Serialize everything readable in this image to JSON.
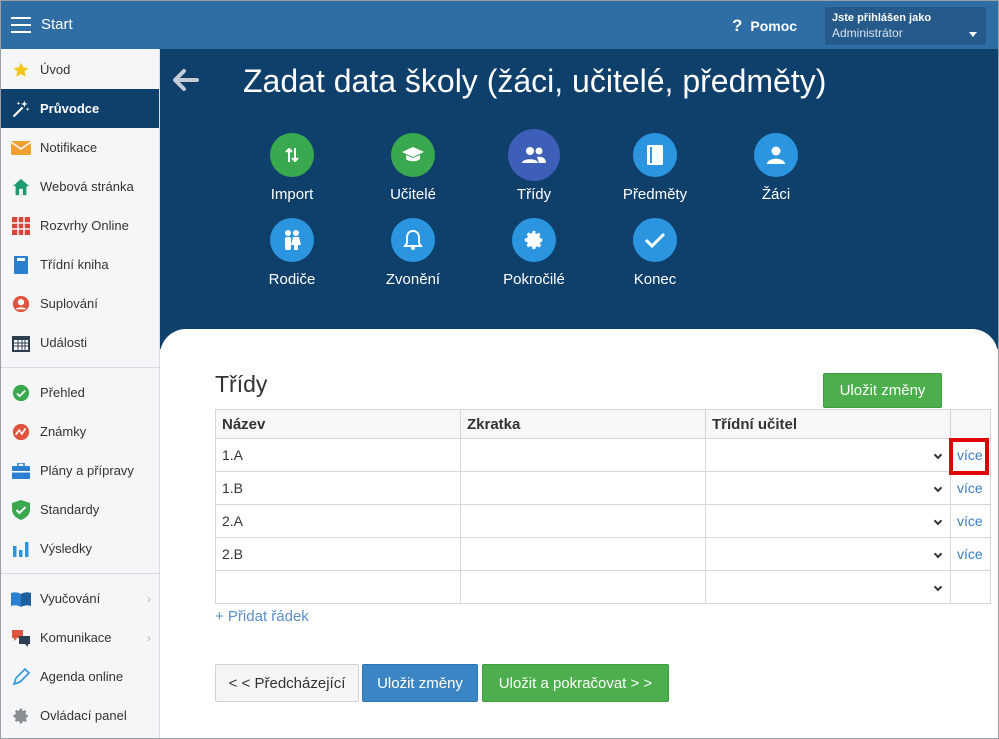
{
  "topbar": {
    "title": "Start",
    "help_label": "Pomoc",
    "user_line1": "Jste přihlášen jako",
    "user_line2": "Administrátor"
  },
  "sidebar": {
    "items": [
      {
        "label": "Úvod",
        "icon": "star-icon"
      },
      {
        "label": "Průvodce",
        "icon": "magic-wand-icon"
      },
      {
        "label": "Notifikace",
        "icon": "envelope-icon"
      },
      {
        "label": "Webová stránka",
        "icon": "house-icon"
      },
      {
        "label": "Rozvrhy Online",
        "icon": "timetable-grid-icon"
      },
      {
        "label": "Třídní kniha",
        "icon": "book-icon"
      },
      {
        "label": "Suplování",
        "icon": "person-icon"
      },
      {
        "label": "Události",
        "icon": "calendar-icon"
      },
      {
        "label": "Přehled",
        "icon": "check-circle-icon"
      },
      {
        "label": "Známky",
        "icon": "grades-icon"
      },
      {
        "label": "Plány a přípravy",
        "icon": "briefcase-icon"
      },
      {
        "label": "Standardy",
        "icon": "shield-check-icon"
      },
      {
        "label": "Výsledky",
        "icon": "bar-chart-icon"
      },
      {
        "label": "Vyučování",
        "icon": "open-book-icon"
      },
      {
        "label": "Komunikace",
        "icon": "chat-bubbles-icon"
      },
      {
        "label": "Agenda online",
        "icon": "pen-icon"
      },
      {
        "label": "Ovládací panel",
        "icon": "gear-icon"
      }
    ]
  },
  "header": {
    "title": "Zadat data školy (žáci, učitelé, předměty)"
  },
  "wizard": {
    "steps": [
      {
        "label": "Import",
        "icon": "import-arrows-icon"
      },
      {
        "label": "Učitelé",
        "icon": "graduation-cap-icon"
      },
      {
        "label": "Třídy",
        "icon": "people-icon"
      },
      {
        "label": "Předměty",
        "icon": "book-icon"
      },
      {
        "label": "Žáci",
        "icon": "person-icon"
      },
      {
        "label": "Rodiče",
        "icon": "parents-icon"
      },
      {
        "label": "Zvonění",
        "icon": "bell-icon"
      },
      {
        "label": "Pokročilé",
        "icon": "gear-icon"
      },
      {
        "label": "Konec",
        "icon": "checkmark-icon"
      }
    ]
  },
  "classes": {
    "title": "Třídy",
    "save_label": "Uložit změny",
    "columns": [
      "Název",
      "Zkratka",
      "Třídní učitel"
    ],
    "rows": [
      {
        "name": "1.A",
        "abbr": "",
        "teacher": "",
        "more": "více"
      },
      {
        "name": "1.B",
        "abbr": "",
        "teacher": "",
        "more": "více"
      },
      {
        "name": "2.A",
        "abbr": "",
        "teacher": "",
        "more": "více"
      },
      {
        "name": "2.B",
        "abbr": "",
        "teacher": "",
        "more": "více"
      },
      {
        "name": "",
        "abbr": "",
        "teacher": "",
        "more": ""
      }
    ],
    "add_row_label": "+ Přidat řádek"
  },
  "footer": {
    "prev_label": "< < Předcházející",
    "save_label": "Uložit změny",
    "save_continue_label": "Uložit a pokračovat > >"
  },
  "colors": {
    "topbar": "#2f6da5",
    "header": "#0f3f6b",
    "green": "#3aa84f",
    "blue": "#2b95e0",
    "active_step": "#3d5fb8",
    "highlight": "#e00000"
  }
}
